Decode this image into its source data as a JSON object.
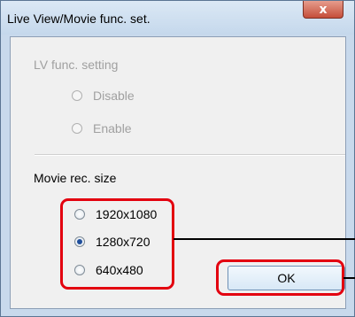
{
  "window": {
    "title": "Live View/Movie func. set.",
    "close_glyph": "x"
  },
  "lv_group": {
    "label": "LV func. setting",
    "options": [
      {
        "label": "Disable",
        "checked": false,
        "enabled": false
      },
      {
        "label": "Enable",
        "checked": false,
        "enabled": false
      }
    ]
  },
  "movie_group": {
    "label": "Movie rec. size",
    "options": [
      {
        "label": "1920x1080",
        "checked": false
      },
      {
        "label": "1280x720",
        "checked": true
      },
      {
        "label": "640x480",
        "checked": false
      }
    ]
  },
  "buttons": {
    "ok_label": "OK"
  },
  "colors": {
    "highlight": "#e3000f"
  }
}
